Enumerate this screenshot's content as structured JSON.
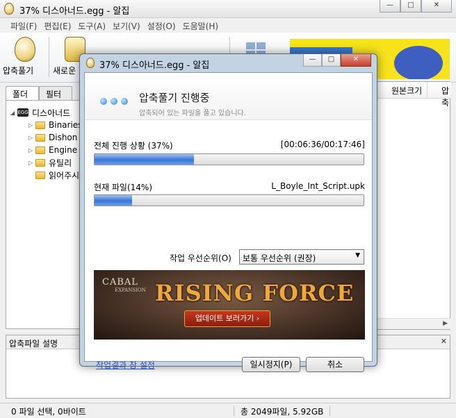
{
  "main_window": {
    "title": "37% 디스아너드.egg - 알집",
    "window_controls": {
      "minimize": "—",
      "maximize": "□",
      "close": "✕"
    }
  },
  "menu": [
    "파일(F)",
    "편집(E)",
    "도구(A)",
    "보기(V)",
    "설정(O)",
    "도움말(H)"
  ],
  "toolbar": {
    "extract_label": "압축풀기",
    "new_label": "새로운"
  },
  "tree": {
    "tabs": [
      "폴더",
      "필터"
    ],
    "root": "디스아너드",
    "root_badge": "EGG",
    "items": [
      "Binaries",
      "Dishon",
      "Engine",
      "유틸리",
      "읽어주시"
    ]
  },
  "file_list": {
    "columns": [
      "원본크기",
      "압축"
    ]
  },
  "description_panel": {
    "title": "압축파일 설명",
    "close": "✕"
  },
  "status": {
    "selection": "0 파일 선택,  0바이트",
    "total": "총 2049파일,  5.92GB"
  },
  "dialog": {
    "title": "37% 디스아너드.egg - 알집",
    "heading": "압축풀기 진행중",
    "subheading": "압축되어 있는 파일을 풀고 있습니다.",
    "overall_label": "전체 진행 상황 (37%)",
    "overall_time": "[00:06:36/00:17:46]",
    "overall_progress": 0.37,
    "current_label": "현재 파일(14%)",
    "current_file": "L_Boyle_Int_Script.upk",
    "current_progress": 0.14,
    "priority_label": "작업 우선순위(O)",
    "priority_value": "보통 우선순위 (권장)",
    "banner": {
      "brand": "CABAL",
      "brand_sub": "EXPANSION",
      "title": "RISING FORCE",
      "button": "업데이트 보러가기 ›"
    },
    "settings_link": "작업결과 창 설정",
    "pause_button": "일시정지(P)",
    "cancel_button": "취소"
  }
}
